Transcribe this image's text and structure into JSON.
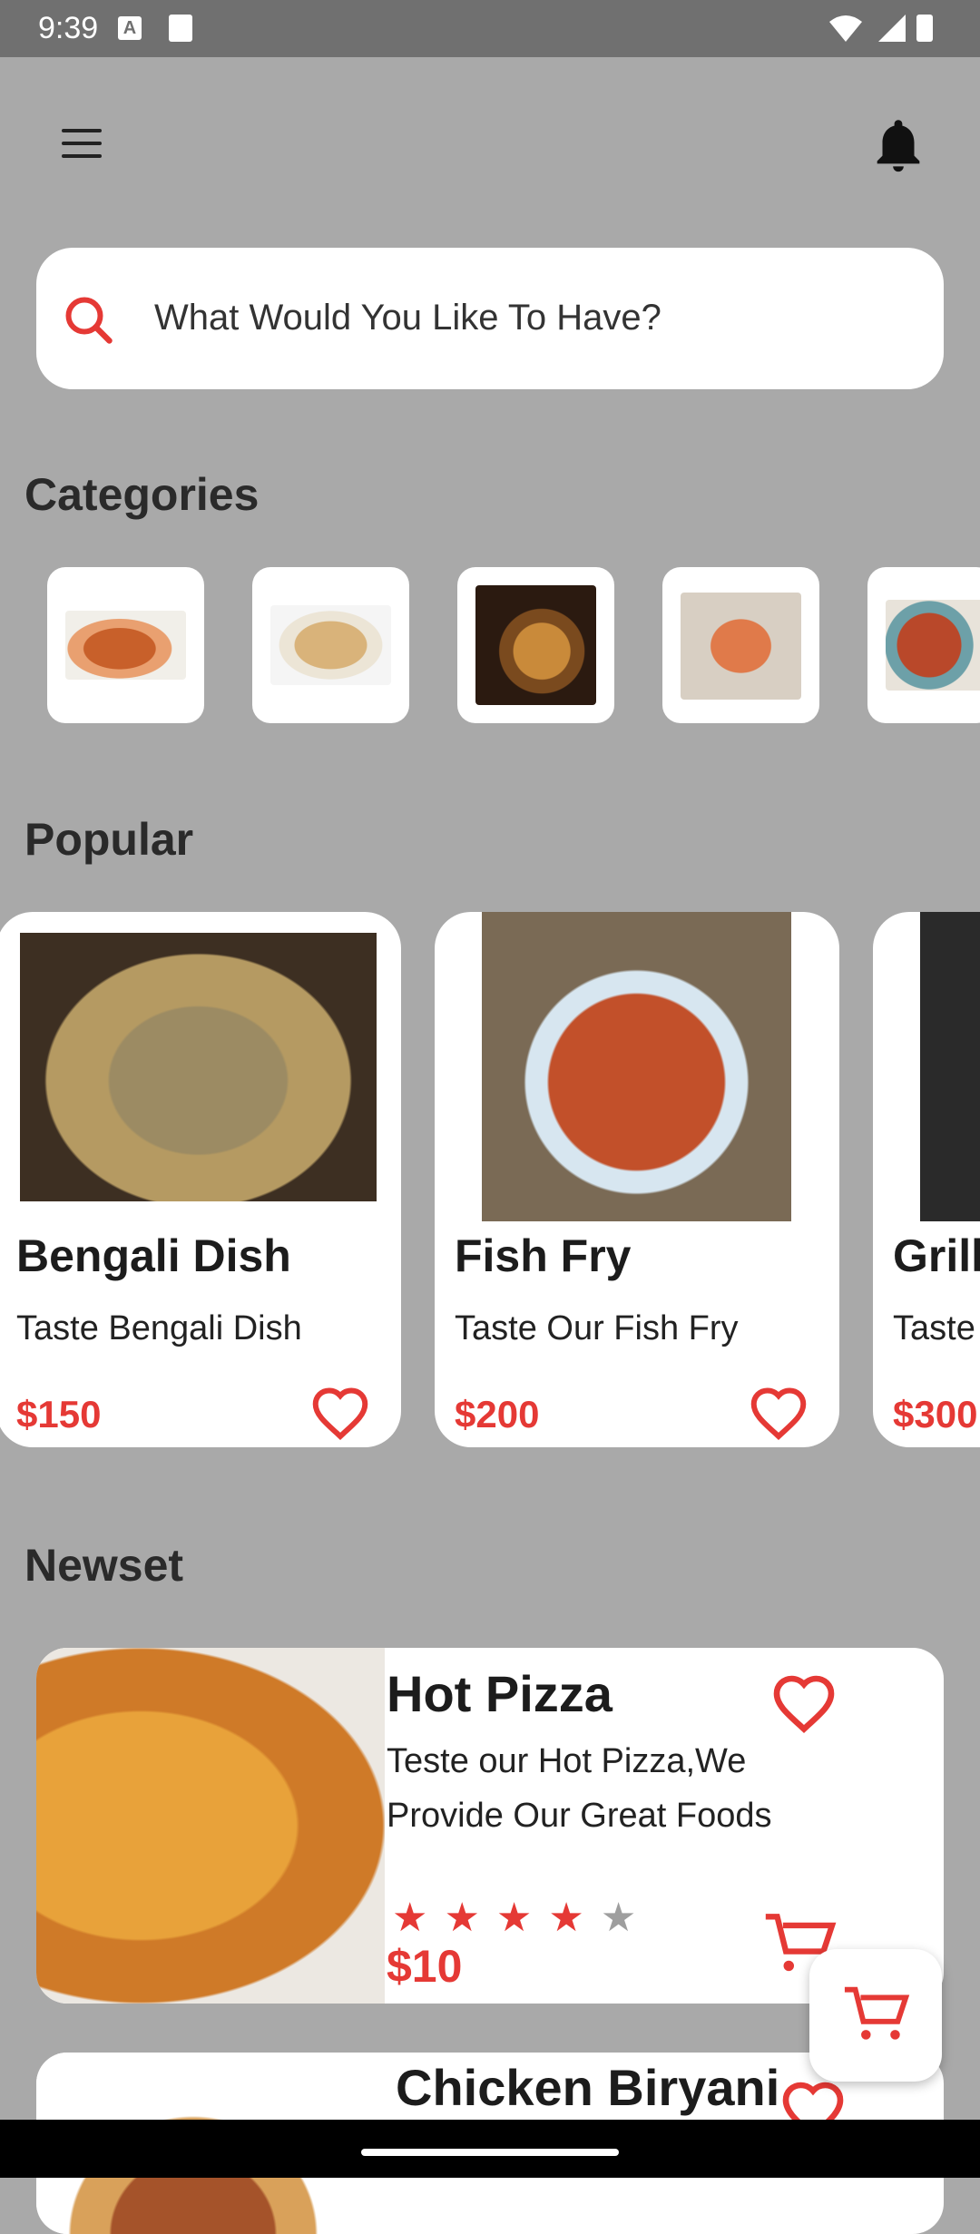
{
  "status_bar": {
    "time": "9:39",
    "notif_letter": "A"
  },
  "header": {
    "menu_icon": "hamburger-menu-icon",
    "bell_icon": "bell-icon"
  },
  "search": {
    "placeholder": "What Would You Like To Have?",
    "icon": "search-icon"
  },
  "categories": {
    "title": "Categories",
    "items": [
      {
        "name": "curry",
        "color": "#c8602a"
      },
      {
        "name": "biryani",
        "color": "#d9b37a"
      },
      {
        "name": "burger",
        "color": "#7a4a1e"
      },
      {
        "name": "skewers",
        "color": "#e07a4a"
      },
      {
        "name": "mixed-dish",
        "color": "#b9482a"
      }
    ]
  },
  "popular": {
    "title": "Popular",
    "items": [
      {
        "name": "Bengali Dish",
        "desc": "Taste Bengali Dish",
        "price": "$150"
      },
      {
        "name": "Fish Fry",
        "desc": "Taste Our Fish Fry",
        "price": "$200"
      },
      {
        "name": "Grill",
        "desc": "Taste",
        "price": "$300"
      }
    ]
  },
  "newest": {
    "title": "Newset",
    "items": [
      {
        "name": "Hot Pizza",
        "desc": "Teste our Hot Pizza,We Provide Our Great Foods",
        "rating": 4,
        "max_rating": 5,
        "price": "$10"
      },
      {
        "name": "Chicken Biryani"
      }
    ]
  },
  "colors": {
    "accent": "#e53935",
    "background": "#a9a9a9"
  }
}
